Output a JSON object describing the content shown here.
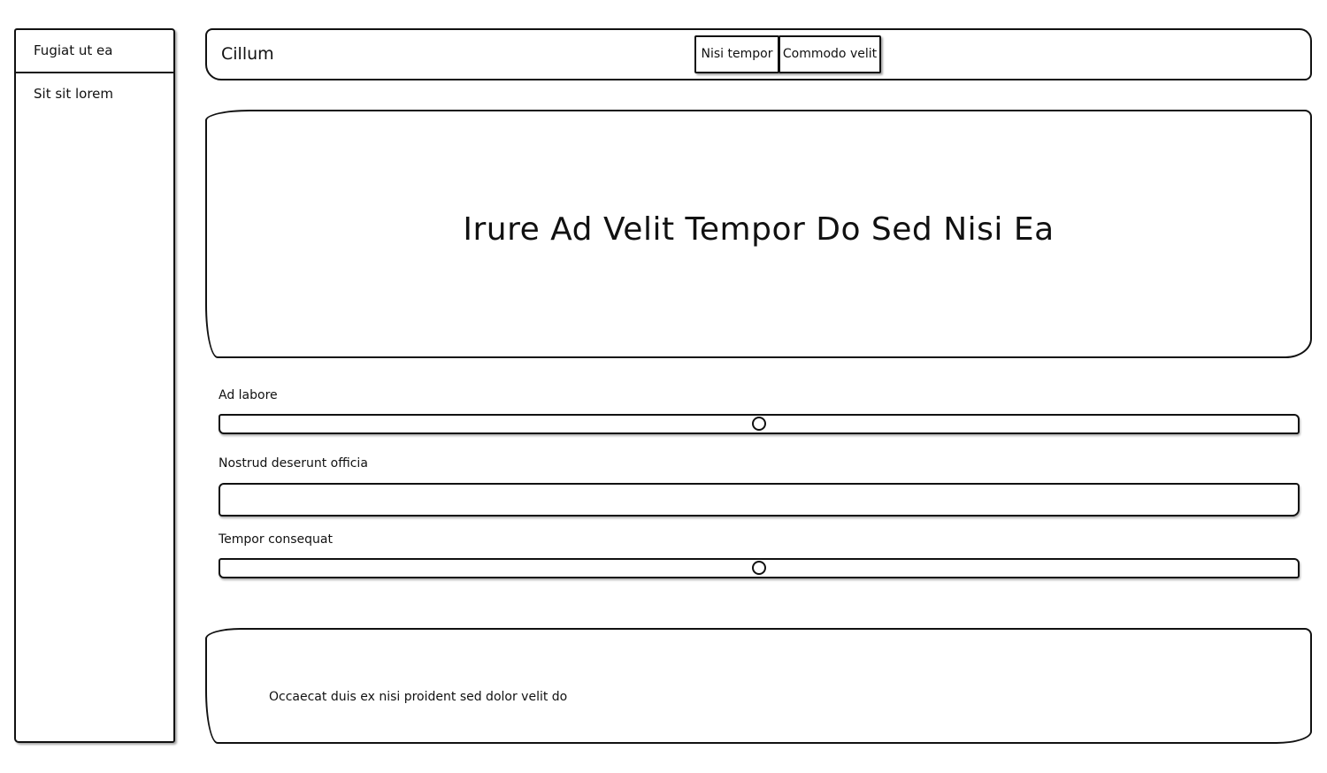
{
  "sidebar": {
    "items": [
      {
        "label": "Fugiat ut ea"
      },
      {
        "label": "Sit sit lorem"
      }
    ]
  },
  "header": {
    "brand": "Cillum",
    "buttons": [
      {
        "label": "Nisi tempor"
      },
      {
        "label": "Commodo velit"
      }
    ]
  },
  "hero": {
    "title": "Irure Ad Velit Tempor Do Sed Nisi Ea"
  },
  "form": {
    "slider_1": {
      "label": "Ad labore",
      "value_fraction": 0.5
    },
    "text_field": {
      "label": "Nostrud deserunt officia",
      "value": ""
    },
    "slider_2": {
      "label": "Tempor consequat",
      "value_fraction": 0.5
    }
  },
  "footer": {
    "text": "Occaecat duis ex nisi proident sed dolor velit do"
  }
}
